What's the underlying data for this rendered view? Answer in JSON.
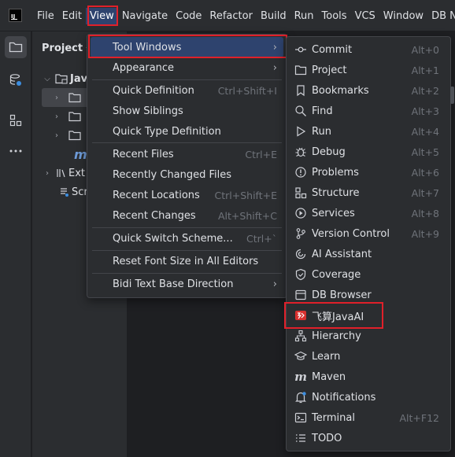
{
  "menubar": {
    "items": [
      "File",
      "Edit",
      "View",
      "Navigate",
      "Code",
      "Refactor",
      "Build",
      "Run",
      "Tools",
      "VCS",
      "Window",
      "DB Na"
    ]
  },
  "project_panel": {
    "title": "Project",
    "chevron": "⌵",
    "rows": [
      {
        "text": "Jav",
        "icon": "module-folder-icon"
      },
      {
        "text": "",
        "icon": "folder-icon"
      },
      {
        "text": "",
        "icon": "folder-icon"
      },
      {
        "text": "",
        "icon": "folder-icon"
      },
      {
        "text": "m",
        "icon": "maven-icon"
      },
      {
        "text": "Ext",
        "icon": "library-icon"
      },
      {
        "text": "Scr",
        "icon": "scratches-icon"
      }
    ]
  },
  "view_menu": {
    "items": [
      {
        "label": "Tool Windows",
        "shortcut": "",
        "submenu": true
      },
      {
        "label": "Appearance",
        "shortcut": "",
        "submenu": true
      },
      {
        "label": "Quick Definition",
        "shortcut": "Ctrl+Shift+I",
        "submenu": false
      },
      {
        "label": "Show Siblings",
        "shortcut": "",
        "submenu": false
      },
      {
        "label": "Quick Type Definition",
        "shortcut": "",
        "submenu": false
      },
      {
        "label": "Recent Files",
        "shortcut": "Ctrl+E",
        "submenu": false
      },
      {
        "label": "Recently Changed Files",
        "shortcut": "",
        "submenu": false
      },
      {
        "label": "Recent Locations",
        "shortcut": "Ctrl+Shift+E",
        "submenu": false
      },
      {
        "label": "Recent Changes",
        "shortcut": "Alt+Shift+C",
        "submenu": false
      },
      {
        "label": "Quick Switch Scheme...",
        "shortcut": "Ctrl+`",
        "submenu": false
      },
      {
        "label": "Reset Font Size in All Editors",
        "shortcut": "",
        "submenu": false
      },
      {
        "label": "Bidi Text Base Direction",
        "shortcut": "",
        "submenu": true
      }
    ]
  },
  "tool_windows_menu": {
    "items": [
      {
        "label": "Commit",
        "shortcut": "Alt+0",
        "icon": "commit-icon"
      },
      {
        "label": "Project",
        "shortcut": "Alt+1",
        "icon": "folder-icon"
      },
      {
        "label": "Bookmarks",
        "shortcut": "Alt+2",
        "icon": "bookmark-icon"
      },
      {
        "label": "Find",
        "shortcut": "Alt+3",
        "icon": "search-icon"
      },
      {
        "label": "Run",
        "shortcut": "Alt+4",
        "icon": "run-icon"
      },
      {
        "label": "Debug",
        "shortcut": "Alt+5",
        "icon": "debug-icon"
      },
      {
        "label": "Problems",
        "shortcut": "Alt+6",
        "icon": "problems-icon"
      },
      {
        "label": "Structure",
        "shortcut": "Alt+7",
        "icon": "structure-icon"
      },
      {
        "label": "Services",
        "shortcut": "Alt+8",
        "icon": "services-icon"
      },
      {
        "label": "Version Control",
        "shortcut": "Alt+9",
        "icon": "version-control-icon"
      },
      {
        "label": "AI Assistant",
        "shortcut": "",
        "icon": "ai-assistant-icon"
      },
      {
        "label": "Coverage",
        "shortcut": "",
        "icon": "coverage-icon"
      },
      {
        "label": "DB Browser",
        "shortcut": "",
        "icon": "db-browser-icon"
      },
      {
        "label": "飞算JavaAI",
        "shortcut": "",
        "icon": "feisuan-javaai-icon"
      },
      {
        "label": "Hierarchy",
        "shortcut": "",
        "icon": "hierarchy-icon"
      },
      {
        "label": "Learn",
        "shortcut": "",
        "icon": "learn-icon"
      },
      {
        "label": "Maven",
        "shortcut": "",
        "icon": "maven-icon"
      },
      {
        "label": "Notifications",
        "shortcut": "",
        "icon": "notifications-icon"
      },
      {
        "label": "Terminal",
        "shortcut": "Alt+F12",
        "icon": "terminal-icon"
      },
      {
        "label": "TODO",
        "shortcut": "",
        "icon": "todo-icon"
      }
    ]
  },
  "colors": {
    "highlight_box": "#e0202a",
    "selection": "#2e436e",
    "background": "#1e1f22",
    "panel": "#2b2d30"
  }
}
